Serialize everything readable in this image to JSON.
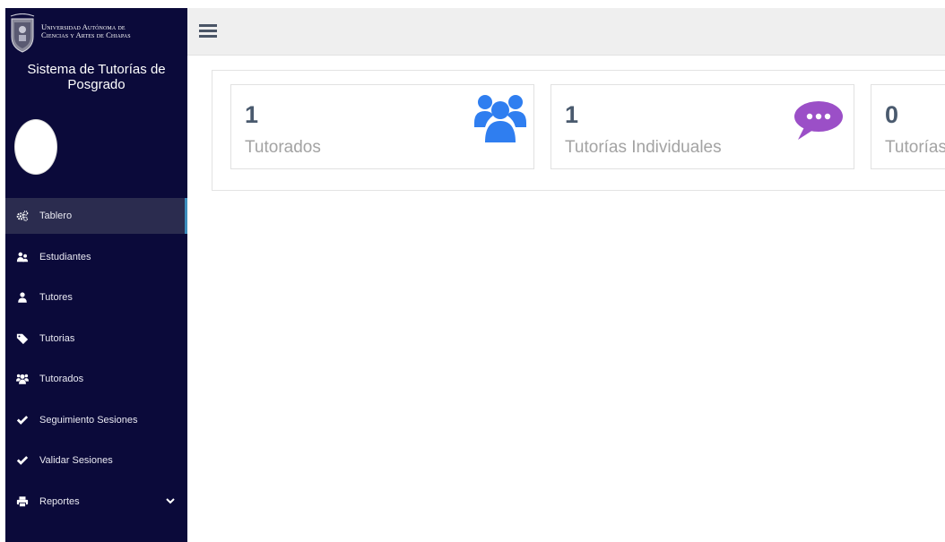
{
  "sidebar": {
    "university": {
      "line1": "Universidad Autónoma de",
      "line2": "Ciencias y Artes de Chiapas"
    },
    "system_title": "Sistema de Tutorías de Posgrado",
    "nav": [
      {
        "label": "Tablero",
        "icon": "gears-icon",
        "active": true
      },
      {
        "label": "Estudiantes",
        "icon": "users-icon"
      },
      {
        "label": "Tutores",
        "icon": "user-icon"
      },
      {
        "label": "Tutorias",
        "icon": "tag-icon"
      },
      {
        "label": "Tutorados",
        "icon": "group-icon"
      },
      {
        "label": "Seguimiento Sesiones",
        "icon": "check-icon"
      },
      {
        "label": "Validar Sesiones",
        "icon": "check-icon"
      },
      {
        "label": "Reportes",
        "icon": "print-icon",
        "has_submenu": true
      }
    ]
  },
  "topbar": {
    "menu_icon": "hamburger-icon"
  },
  "dashboard": {
    "cards": [
      {
        "count": "1",
        "label": "Tutorados",
        "icon": "group-icon",
        "icon_color": "#2f7ef0"
      },
      {
        "count": "1",
        "label": "Tutorías Individuales",
        "icon": "chat-bubble-icon",
        "icon_color": "#9b4fc7"
      },
      {
        "count": "0",
        "label": "Tutorías"
      }
    ]
  },
  "colors": {
    "sidebar_bg": "#0b0a3a",
    "active_item_bg": "#2b2c4f",
    "active_indicator": "#3c8dbc",
    "topbar_bg": "#efefef"
  }
}
